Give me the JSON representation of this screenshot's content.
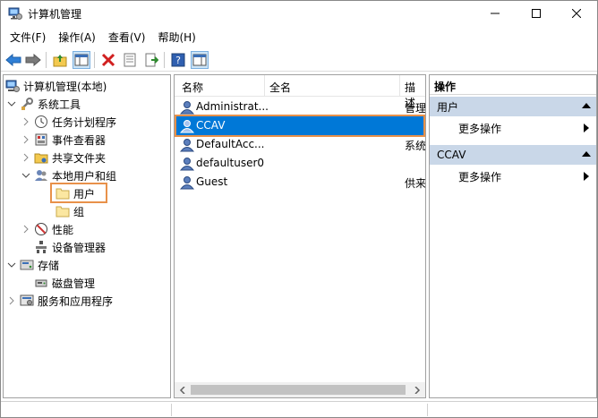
{
  "window": {
    "title": "计算机管理"
  },
  "menu": [
    "文件(F)",
    "操作(A)",
    "查看(V)",
    "帮助(H)"
  ],
  "tree": {
    "root": "计算机管理(本地)",
    "system_tools": "系统工具",
    "task_scheduler": "任务计划程序",
    "event_viewer": "事件查看器",
    "shared_folders": "共享文件夹",
    "local_users_groups": "本地用户和组",
    "users": "用户",
    "groups": "组",
    "performance": "性能",
    "device_manager": "设备管理器",
    "storage": "存储",
    "disk_management": "磁盘管理",
    "services_apps": "服务和应用程序"
  },
  "list": {
    "columns": [
      "名称",
      "全名",
      "描述"
    ],
    "rows": [
      {
        "name": "Administrat...",
        "desc": "管理"
      },
      {
        "name": "CCAV",
        "desc": ""
      },
      {
        "name": "DefaultAcc...",
        "desc": "系统"
      },
      {
        "name": "defaultuser0",
        "desc": ""
      },
      {
        "name": "Guest",
        "desc": "供来"
      }
    ]
  },
  "actions": {
    "header": "操作",
    "group1": "用户",
    "group1_item": "更多操作",
    "group2": "CCAV",
    "group2_item": "更多操作"
  },
  "colors": {
    "selection": "#0078d7",
    "highlight": "#e8914a",
    "group_bg": "#c9d7e8"
  }
}
